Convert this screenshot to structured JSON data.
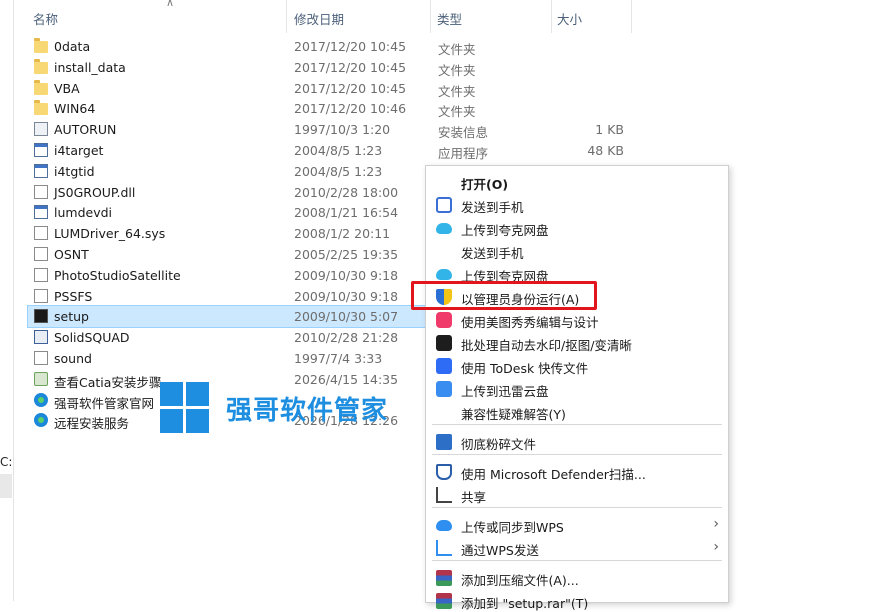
{
  "columns": {
    "name": "名称",
    "modified": "修改日期",
    "type": "类型",
    "size": "大小"
  },
  "files": [
    {
      "name": "0data",
      "date": "2017/12/20 10:45",
      "type": "文件夹",
      "size": "",
      "icon": "folder-icon"
    },
    {
      "name": "install_data",
      "date": "2017/12/20 10:45",
      "type": "文件夹",
      "size": "",
      "icon": "folder-icon"
    },
    {
      "name": "VBA",
      "date": "2017/12/20 10:45",
      "type": "文件夹",
      "size": "",
      "icon": "folder-icon"
    },
    {
      "name": "WIN64",
      "date": "2017/12/20 10:46",
      "type": "文件夹",
      "size": "",
      "icon": "folder-icon"
    },
    {
      "name": "AUTORUN",
      "date": "1997/10/3 1:20",
      "type": "安装信息",
      "size": "1 KB",
      "icon": "setup-info-icon"
    },
    {
      "name": "i4target",
      "date": "2004/8/5 1:23",
      "type": "应用程序",
      "size": "48 KB",
      "icon": "application-icon"
    },
    {
      "name": "i4tgtid",
      "date": "2004/8/5 1:23",
      "type": "",
      "size": "",
      "icon": "application-icon"
    },
    {
      "name": "JS0GROUP.dll",
      "date": "2010/2/28 18:00",
      "type": "",
      "size": "",
      "icon": "dll-icon"
    },
    {
      "name": "lumdevdi",
      "date": "2008/1/21 16:54",
      "type": "",
      "size": "",
      "icon": "application-icon"
    },
    {
      "name": "LUMDriver_64.sys",
      "date": "2008/1/2 20:11",
      "type": "",
      "size": "",
      "icon": "file-icon"
    },
    {
      "name": "OSNT",
      "date": "2005/2/25 19:35",
      "type": "",
      "size": "",
      "icon": "file-icon"
    },
    {
      "name": "PhotoStudioSatellite",
      "date": "2009/10/30 9:18",
      "type": "",
      "size": "",
      "icon": "file-icon"
    },
    {
      "name": "PSSFS",
      "date": "2009/10/30 9:18",
      "type": "",
      "size": "",
      "icon": "file-icon"
    },
    {
      "name": "setup",
      "date": "2009/10/30 5:07",
      "type": "",
      "size": "",
      "icon": "setup-app-icon"
    },
    {
      "name": "SolidSQUAD",
      "date": "2010/2/28 21:28",
      "type": "",
      "size": "",
      "icon": "solidsquad-icon"
    },
    {
      "name": "sound",
      "date": "1997/7/4 3:33",
      "type": "",
      "size": "",
      "icon": "sound-file-icon"
    },
    {
      "name": "查看Catia安装步骤",
      "date": "2026/4/15 14:35",
      "type": "",
      "size": "",
      "icon": "text-doc-icon"
    },
    {
      "name": "强哥软件管家官网",
      "date": "",
      "type": "",
      "size": "",
      "icon": "edge-icon"
    },
    {
      "name": "远程安装服务",
      "date": "2026/1/28 12:26",
      "type": "",
      "size": "",
      "icon": "edge-icon"
    }
  ],
  "watermark": {
    "text": "强哥软件管家"
  },
  "left_panel": {
    "label": "C:"
  },
  "context_menu": {
    "items": [
      {
        "label": "打开(O)",
        "icon": "",
        "bold": true,
        "submenu": false
      },
      {
        "label": "发送到手机",
        "icon": "phone-icon",
        "submenu": false
      },
      {
        "label": "上传到夸克网盘",
        "icon": "quark-cloud-icon",
        "submenu": false
      },
      {
        "label": "发送到手机",
        "icon": "",
        "submenu": false
      },
      {
        "label": "上传到夸克网盘",
        "icon": "quark-cloud-icon",
        "submenu": false
      },
      {
        "label": "以管理员身份运行(A)",
        "icon": "uac-shield-icon",
        "submenu": false
      },
      {
        "label": "使用美图秀秀编辑与设计",
        "icon": "meitu-icon",
        "submenu": false
      },
      {
        "label": "批处理自动去水印/抠图/变清晰",
        "icon": "batch-process-icon",
        "submenu": false
      },
      {
        "label": "使用 ToDesk 快传文件",
        "icon": "todesk-icon",
        "submenu": false
      },
      {
        "label": "上传到迅雷云盘",
        "icon": "xunlei-icon",
        "submenu": false
      },
      {
        "label": "兼容性疑难解答(Y)",
        "icon": "",
        "submenu": false
      },
      {
        "label": "彻底粉碎文件",
        "icon": "shredder-icon",
        "submenu": false
      },
      {
        "label": "使用 Microsoft Defender扫描...",
        "icon": "defender-icon",
        "submenu": false
      },
      {
        "label": "共享",
        "icon": "share-icon",
        "submenu": false
      },
      {
        "label": "上传或同步到WPS",
        "icon": "wps-cloud-icon",
        "submenu": true
      },
      {
        "label": "通过WPS发送",
        "icon": "wps-send-icon",
        "submenu": true
      },
      {
        "label": "添加到压缩文件(A)...",
        "icon": "winrar-icon",
        "submenu": false
      },
      {
        "label": "添加到 \"setup.rar\"(T)",
        "icon": "winrar-icon",
        "submenu": false
      }
    ]
  },
  "highlight_target": "以管理员身份运行(A)"
}
